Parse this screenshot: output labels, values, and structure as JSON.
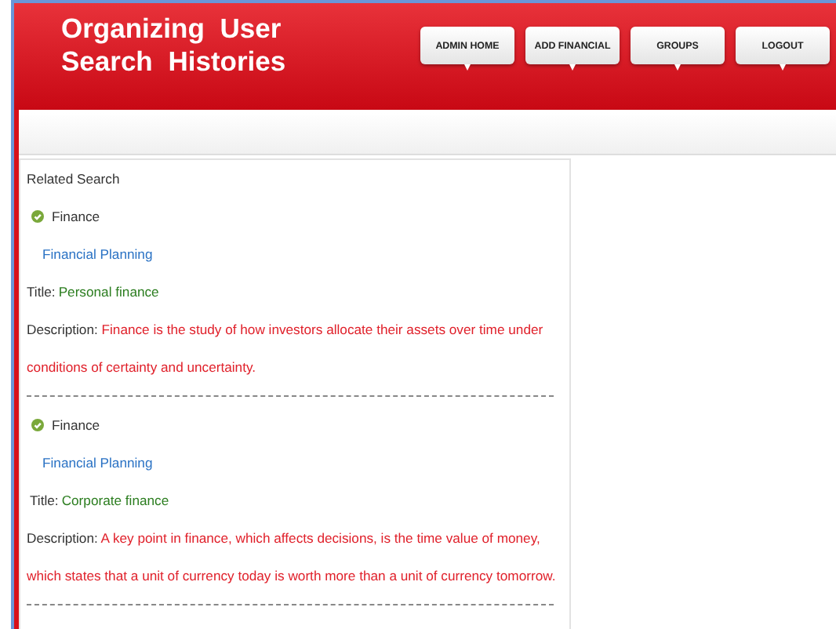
{
  "header": {
    "title": "Organizing User Search Histories"
  },
  "nav": [
    {
      "label": "ADMIN HOME"
    },
    {
      "label": "ADD FINANCIAL"
    },
    {
      "label": "GROUPS"
    },
    {
      "label": "LOGOUT"
    }
  ],
  "content": {
    "heading": "Related Search",
    "results": [
      {
        "category": "Finance",
        "link": "Financial Planning",
        "title_label": "Title:",
        "title": "Personal finance",
        "description_label": "Description:",
        "description": "Finance is the study of how investors allocate their assets over time under conditions of certainty and uncertainty."
      },
      {
        "category": "Finance",
        "link": "Financial Planning",
        "title_label": "Title:",
        "title": "Corporate finance",
        "description_label": "Description:",
        "description": "A key point in finance, which affects decisions, is the time value of money, which states that a unit of currency today is worth more than a unit of currency tomorrow."
      }
    ]
  }
}
